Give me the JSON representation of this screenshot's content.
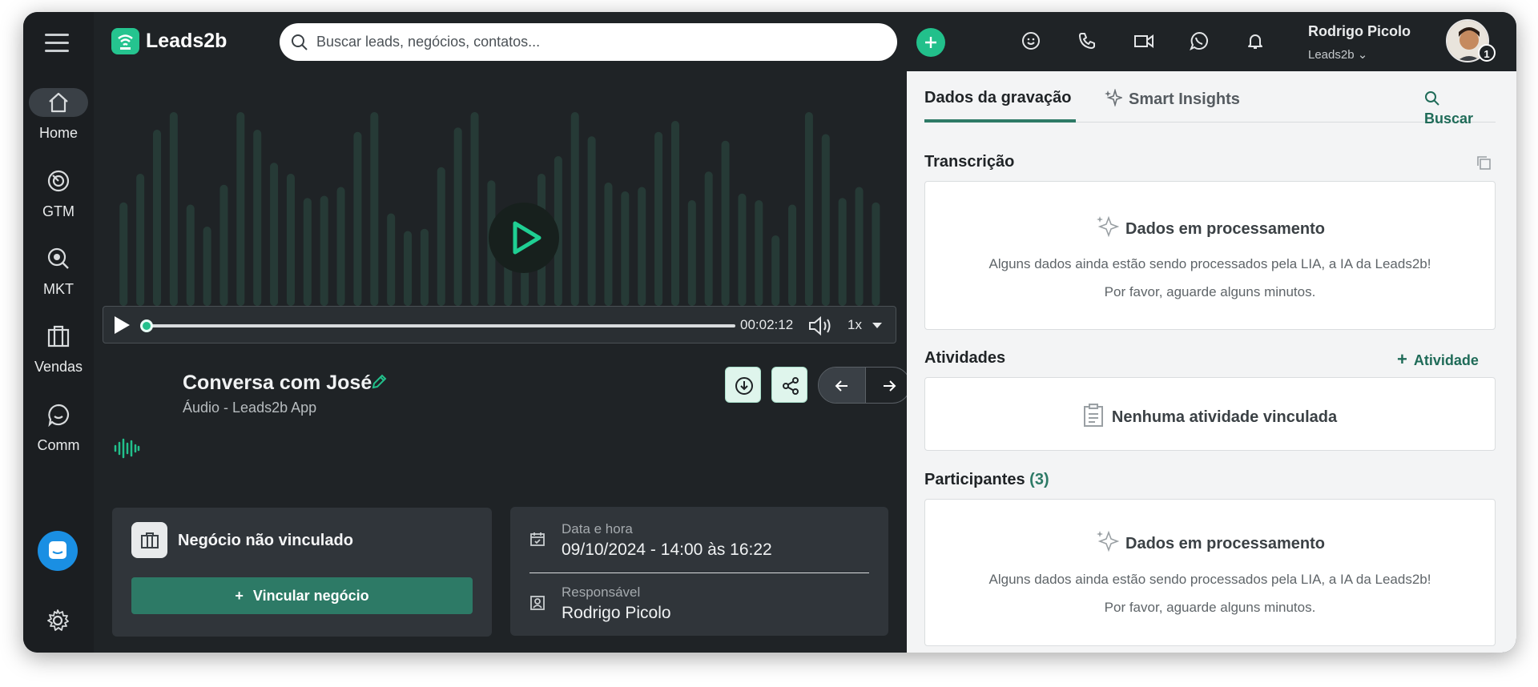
{
  "app": {
    "brand": "Leads2b",
    "search_placeholder": "Buscar leads, negócios, contatos...",
    "user": {
      "name": "Rodrigo Picolo",
      "org": "Leads2b",
      "notification_count": "1"
    }
  },
  "sidebar": {
    "items": [
      {
        "label": "Home",
        "icon": "home-icon"
      },
      {
        "label": "GTM",
        "icon": "target-icon"
      },
      {
        "label": "MKT",
        "icon": "magnifier-icon"
      },
      {
        "label": "Vendas",
        "icon": "briefcase-icon"
      },
      {
        "label": "Comm",
        "icon": "chat-icon"
      }
    ]
  },
  "player": {
    "time": "00:02:12",
    "speed": "1x",
    "progress": 0.0
  },
  "recording": {
    "title": "Conversa com José",
    "subtitle": "Áudio - Leads2b App"
  },
  "deal": {
    "title": "Negócio não vinculado",
    "link_button": "Vincular negócio"
  },
  "details": {
    "date_label": "Data e hora",
    "date_value": "09/10/2024 - 14:00 às 16:22",
    "owner_label": "Responsável",
    "owner_value": "Rodrigo Picolo"
  },
  "panel": {
    "tabs": [
      "Dados da gravação",
      "Smart Insights"
    ],
    "search_label": "Buscar",
    "transcription": {
      "title": "Transcrição",
      "status": "Dados em processamento",
      "line1": "Alguns dados ainda estão sendo processados pela LIA, a IA da Leads2b!",
      "line2": "Por favor, aguarde alguns minutos."
    },
    "activities": {
      "title": "Atividades",
      "add_label": "Atividade",
      "empty": "Nenhuma atividade vinculada"
    },
    "participants": {
      "title": "Participantes",
      "count": "(3)",
      "status": "Dados em processamento",
      "line1": "Alguns dados ainda estão sendo processados pela LIA, a IA da Leads2b!",
      "line2": "Por favor, aguarde alguns minutos."
    }
  },
  "colors": {
    "accent": "#22c08b",
    "accent_dark": "#2d7a66",
    "sidebar_bg": "#1b1e21",
    "main_bg": "#1f2326",
    "panel_bg": "#f3f4f5"
  }
}
